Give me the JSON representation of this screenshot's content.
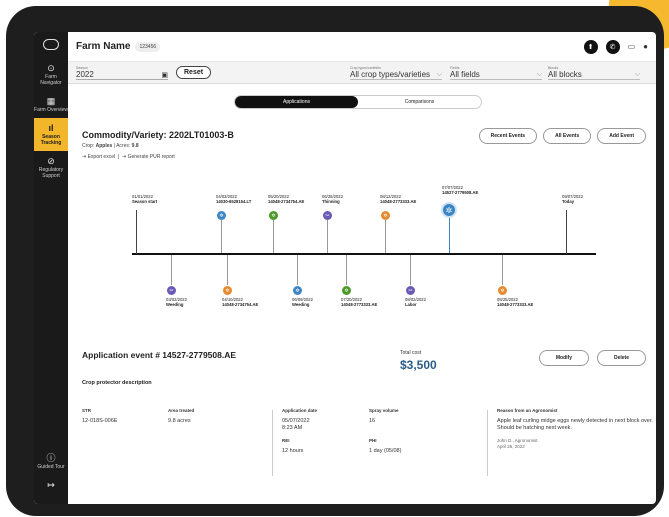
{
  "topbar": {
    "farm_name": "Farm Name",
    "farm_id": "123456"
  },
  "sidebar": {
    "items": [
      {
        "label": "Farm Navigator",
        "icon": "compass-icon",
        "glyph": "⊙"
      },
      {
        "label": "Farm Overview",
        "icon": "grid-icon",
        "glyph": "▦"
      },
      {
        "label": "Season Tracking",
        "icon": "bar-chart-icon",
        "glyph": "ıl"
      },
      {
        "label": "Regulatory Support",
        "icon": "check-circle-icon",
        "glyph": "⊘"
      }
    ],
    "bottom": [
      {
        "label": "Guided Tour",
        "icon": "info-icon",
        "glyph": "ⓘ"
      },
      {
        "label": "",
        "icon": "logout-icon",
        "glyph": "↦"
      }
    ]
  },
  "filters": {
    "season": {
      "label": "Season",
      "value": "2022"
    },
    "reset_label": "Reset",
    "crop": {
      "label": "Crop types/varieties",
      "value": "All crop types/varieties"
    },
    "fields": {
      "label": "Fields",
      "value": "All fields"
    },
    "blocks": {
      "label": "Blocks",
      "value": "All blocks"
    }
  },
  "tabs": {
    "applications": "Applications",
    "comparisons": "Comparisons"
  },
  "commodity": {
    "title": "Commodity/Variety: 2202LT01003-B",
    "crop_label": "Crop: ",
    "crop_value": "Apples",
    "acres_label": " | Acres: ",
    "acres_value": "9.8",
    "export_excel": "Export excel",
    "purr_report": "Generate PUR report"
  },
  "event_buttons": {
    "recent": "Recent Events",
    "all": "All Events",
    "add": "Add Event"
  },
  "timeline": {
    "top": [
      {
        "date": "01/01/2022",
        "name": "Season start"
      },
      {
        "date": "04/03/2022",
        "name": "14030-6528154.LT"
      },
      {
        "date": "05/20/2022",
        "name": "14048-2734754.AE"
      },
      {
        "date": "06/25/2022",
        "name": "Thinning"
      },
      {
        "date": "08/12/2022",
        "name": "14048-2773333.AE"
      },
      {
        "date": "07/07/2022",
        "name": "14527-2779508.AE"
      },
      {
        "date": "09/07/2022",
        "name": "Today"
      }
    ],
    "bottom": [
      {
        "date": "03/02/2022",
        "name": "Weeding"
      },
      {
        "date": "04/10/2022",
        "name": "14048-2734754.AE"
      },
      {
        "date": "06/09/2022",
        "name": "Weeding"
      },
      {
        "date": "07/20/2022",
        "name": "14048-2773333.AE"
      },
      {
        "date": "08/02/2022",
        "name": "Labor"
      },
      {
        "date": "08/25/2022",
        "name": "14048-2773333.AE"
      }
    ]
  },
  "detail": {
    "title": "Application event # 14527-2779508.AE",
    "cost_label": "Total cost",
    "cost_value": "$3,500",
    "modify": "Modify",
    "delete": "Delete",
    "section": "Crop protector description",
    "str_label": "STR",
    "str_value": "12-018S-006E",
    "area_label": "Area treated",
    "area_value": "9.8 acres",
    "app_date_label": "Application date",
    "app_date_value": "05/07/2022",
    "app_time_value": "8:23 AM",
    "spray_label": "Spray volume",
    "spray_value": "16",
    "rei_label": "REI",
    "rei_value": "12 hours",
    "phi_label": "PHI",
    "phi_value": "1 day (05/08)",
    "reason_label": "Reason from an Agronomist",
    "reason_text": "Apple leaf curling midge eggs newly detected in next block over. Should be hatching next week.",
    "reason_author": "John D., Agronomist",
    "reason_date": "April 25, 2022"
  },
  "colors": {
    "accent": "#f2b62b",
    "blue": "#3d86c6",
    "green": "#4c9a2a",
    "orange": "#e58a2e",
    "purple": "#6a5ab5",
    "sidebar": "#1a1a1a"
  }
}
